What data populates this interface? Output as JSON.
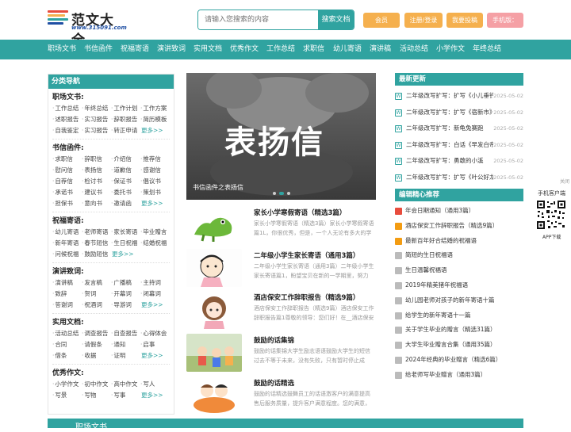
{
  "header": {
    "logo_title": "范文大全",
    "logo_url": "www.315091.com",
    "search_placeholder": "请输入您搜索的内容",
    "search_button": "搜索文档",
    "buttons": [
      "会员",
      "注册/登录",
      "我要投稿",
      "手机版：app"
    ],
    "button_colors": [
      "#f5b04e",
      "#f5b04e",
      "#f5b04e",
      "#f5a0a5"
    ]
  },
  "nav": [
    "职场文书",
    "书信函件",
    "祝福寄语",
    "演讲致词",
    "实用文档",
    "优秀作文",
    "工作总结",
    "求职信",
    "幼儿寄语",
    "演讲稿",
    "活动总结",
    "小学作文",
    "年终总结"
  ],
  "sidebar": {
    "title": "分类导航",
    "categories": [
      {
        "name": "职场文书:",
        "rows": [
          [
            "工作总结",
            "年终总结",
            "工作计划",
            "工作方案"
          ],
          [
            "述职报告",
            "实习报告",
            "辞职报告",
            "简历模板"
          ],
          [
            "自我鉴定",
            "实习报告",
            "转正申请",
            "更多>>"
          ]
        ]
      },
      {
        "name": "书信函件:",
        "rows": [
          [
            "求职信",
            "辞职信",
            "介绍信",
            "推荐信"
          ],
          [
            "慰问信",
            "表扬信",
            "道歉信",
            "感谢信"
          ],
          [
            "自荐信",
            "检讨书",
            "保证书",
            "倡议书"
          ],
          [
            "承诺书",
            "建议书",
            "委托书",
            "策划书"
          ],
          [
            "担保书",
            "意向书",
            "邀请函",
            "更多>>"
          ]
        ]
      },
      {
        "name": "祝福寄语:",
        "rows": [
          [
            "幼儿寄语",
            "老师寄语",
            "家长寄语",
            "毕业赠言"
          ],
          [
            "新年寄语",
            "春节短信",
            "生日祝福",
            "结婚祝福"
          ],
          [
            "问候祝福",
            "鼓励短信",
            "更多>>"
          ]
        ]
      },
      {
        "name": "演讲致词:",
        "rows": [
          [
            "演讲稿",
            "发言稿",
            "广播稿",
            "主持词"
          ],
          [
            "致辞",
            "贺词",
            "开幕词",
            "闭幕词"
          ],
          [
            "答谢词",
            "祝酒词",
            "导游词",
            "更多>>"
          ]
        ]
      },
      {
        "name": "实用文档:",
        "rows": [
          [
            "活动总结",
            "调查报告",
            "自查报告",
            "心得体会"
          ],
          [
            "合同",
            "请假条",
            "通知",
            "启事"
          ],
          [
            "借条",
            "收据",
            "证明",
            "更多>>"
          ]
        ]
      },
      {
        "name": "优秀作文:",
        "rows": [
          [
            "小学作文",
            "初中作文",
            "高中作文",
            "写人"
          ],
          [
            "写景",
            "写物",
            "写事",
            "更多>>"
          ]
        ]
      }
    ]
  },
  "banner": {
    "big_text": "表扬信",
    "caption": "书信函件之表扬信"
  },
  "articles": [
    {
      "title": "家长小学寒假寄语（精选3篇）",
      "desc": "家长小学寒假寄语（精选3篇）家长小学寒假寄语篇1L，你很优秀，但是，一个人无论有多大的学"
    },
    {
      "title": "二年级小学生家长寄语（通用3篇）",
      "desc": "二年级小学生家长寄语（通用3篇）二年级小学生家长寄语篇1，盼望宝贝在新的一学期里，努力"
    },
    {
      "title": "酒店保安工作辞职报告（精选9篇）",
      "desc": "酒店保安工作辞职报告（精选9篇）酒店保安工作辞职报告篇1尊敬的领导：您们好！在__酒店保安队"
    },
    {
      "title": "鼓励的话集锦",
      "desc": "鼓励的话集锦大学生励志语语鼓励大学生的短信过去不等于未来，没有失败，只有暂时停止成"
    },
    {
      "title": "鼓励的话精选",
      "desc": "鼓励的话精选鼓舞员工的话语激客户的满意提高售后服务质量，提升客户满意程度。您的满意，"
    }
  ],
  "latest": {
    "title": "最新更新",
    "items": [
      {
        "text": "二年级改写扩写：扩写《小儿垂钓》",
        "date": "2025-05-02"
      },
      {
        "text": "二年级改写扩写：扩写《宿新市》",
        "date": "2025-05-02"
      },
      {
        "text": "二年级改写扩写：新龟兔赛跑",
        "date": "2025-05-02"
      },
      {
        "text": "二年级改写扩写：白话《早发白帝城》",
        "date": "2025-05-02"
      },
      {
        "text": "二年级改写扩写：勇敢的小溪",
        "date": "2025-05-02"
      },
      {
        "text": "二年级改写扩写：扩写《叶公好龙》",
        "date": "2025-05-02"
      }
    ]
  },
  "recommend": {
    "title": "编辑精心推荐",
    "items": [
      "年会日期通知（通用3篇）",
      "酒店保安工作辞职报告（精选9篇）",
      "最新百年好合结婚的祝福语",
      "简短的生日祝福语",
      "生日温馨祝福语",
      "2019年精美猪年祝福语",
      "幼儿园老师对孩子的新年寄语十篇",
      "给学生的新年寄语十一篇",
      "关于学生毕业的赠言（精选31篇）",
      "大学生毕业赠言合集（通用35篇）",
      "2024年经典的毕业赠言（精选6篇）",
      "给老师写毕业赠言（通用3篇）"
    ],
    "num_colors": [
      "#e84c3d",
      "#f39c12",
      "#f39c12",
      "#bbbbbb",
      "#bbbbbb",
      "#bbbbbb",
      "#bbbbbb",
      "#bbbbbb",
      "#bbbbbb",
      "#bbbbbb",
      "#bbbbbb",
      "#bbbbbb"
    ]
  },
  "mobile": {
    "close": "关闭",
    "title": "手机客户端",
    "download": "APP下载"
  },
  "section_footer": "职场文书"
}
